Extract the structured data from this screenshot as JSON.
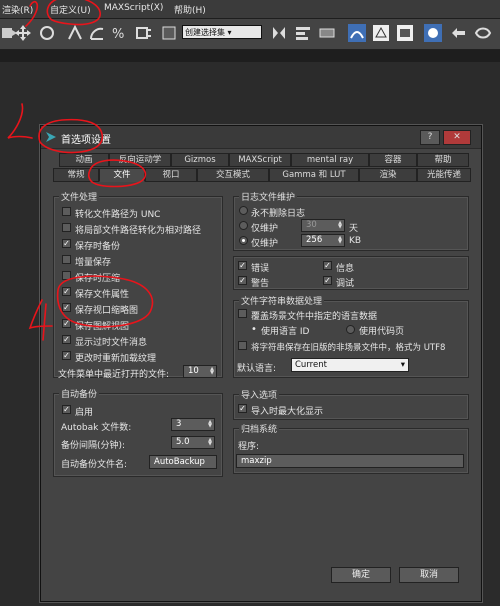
{
  "menubar": {
    "items": [
      "渲染(R)",
      "自定义(U)",
      "MAXScript(X)",
      "帮助(H)"
    ]
  },
  "toolbar": {
    "selection_set_placeholder": "创建选择集"
  },
  "dialog": {
    "title": "首选项设置",
    "help_button": "?",
    "close_button": "✕",
    "tabs_row1": [
      "动画",
      "反向运动学",
      "Gizmos",
      "MAXScript",
      "mental ray",
      "容器",
      "帮助"
    ],
    "tabs_row2": [
      "常规",
      "文件",
      "视口",
      "交互模式",
      "Gamma 和 LUT",
      "渲染",
      "光能传递"
    ],
    "file_handling": {
      "label": "文件处理",
      "options": [
        {
          "label": "转化文件路径为 UNC",
          "checked": false
        },
        {
          "label": "将局部文件路径转化为相对路径",
          "checked": false
        },
        {
          "label": "保存时备份",
          "checked": true
        },
        {
          "label": "增量保存",
          "checked": false
        },
        {
          "label": "保存时压缩",
          "checked": false
        },
        {
          "label": "保存文件属性",
          "checked": true
        },
        {
          "label": "保存视口缩略图",
          "checked": true
        },
        {
          "label": "保存图解视图",
          "checked": true
        },
        {
          "label": "显示过时文件消息",
          "checked": true
        },
        {
          "label": "更改时重新加载纹理",
          "checked": true
        }
      ],
      "recent_files_label": "文件菜单中最近打开的文件:",
      "recent_files_value": "10"
    },
    "log_maintenance": {
      "label": "日志文件维护",
      "never_delete": "永不删除日志",
      "keep_days_label": "仅维护",
      "keep_days_value": "30",
      "keep_days_unit": "天",
      "keep_kb_label": "仅维护",
      "keep_kb_value": "256",
      "keep_kb_unit": "KB",
      "types": [
        {
          "label": "错误",
          "checked": true
        },
        {
          "label": "信息",
          "checked": true
        },
        {
          "label": "警告",
          "checked": true
        },
        {
          "label": "调试",
          "checked": true
        }
      ]
    },
    "string_data": {
      "label": "文件字符串数据处理",
      "override": "覆盖场景文件中指定的语言数据",
      "use_language_id": "使用语言 ID",
      "use_code_page": "使用代码页",
      "utf8": "将字符串保存在旧版的非场景文件中，格式为 UTF8",
      "default_language_label": "默认语言:",
      "default_language_value": "Current"
    },
    "auto_backup": {
      "label": "自动备份",
      "enable": "启用",
      "count_label": "Autobak 文件数:",
      "count_value": "3",
      "interval_label": "备份间隔(分钟):",
      "interval_value": "5.0",
      "name_label": "自动备份文件名:",
      "name_value": "AutoBackup"
    },
    "import_options": {
      "label": "导入选项",
      "zoom_extents": "导入时最大化显示"
    },
    "archive_system": {
      "label": "归档系统",
      "program_label": "程序:",
      "program_value": "maxzip"
    },
    "ok": "确定",
    "cancel": "取消"
  },
  "annotations": [
    "2",
    "4"
  ],
  "colors": {
    "annotation": "#e8141b",
    "dialog_bg": "#444444",
    "toolbar_highlight": "#3f6fb5"
  }
}
